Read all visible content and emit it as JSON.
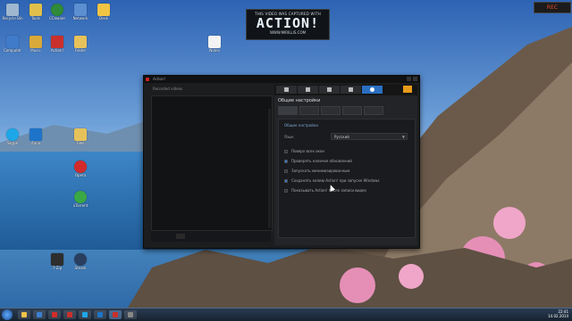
{
  "banner": {
    "line1": "THIS VIDEO WAS CAPTURED WITH",
    "logo": "ACTION!",
    "url": "WWW.MIRILLIS.COM"
  },
  "recorder": {
    "label": "REC"
  },
  "desktop_icons": [
    {
      "label": "Recycle Bin",
      "color": "#9fb7cf"
    },
    {
      "label": "Tools",
      "color": "#e0c04a"
    },
    {
      "label": "CCleaner",
      "color": "#2f8a3a"
    },
    {
      "label": "Network",
      "color": "#5b8fd1"
    },
    {
      "label": "Desk",
      "color": "#f2c443"
    },
    {
      "label": "Computer",
      "color": "#3f7bc9"
    },
    {
      "label": "Music",
      "color": "#d9a93a"
    },
    {
      "label": "Action!",
      "color": "#c9302c"
    },
    {
      "label": "Folder",
      "color": "#e7c25a"
    },
    {
      "label": "Skype",
      "color": "#1ea7e8"
    },
    {
      "label": "Zona",
      "color": "#1d74c8"
    },
    {
      "label": "Files",
      "color": "#e7c25a"
    },
    {
      "label": "Opera",
      "color": "#d32b2b"
    },
    {
      "label": "uTorrent",
      "color": "#3aa845"
    },
    {
      "label": "Steam",
      "color": "#2a3f5f"
    },
    {
      "label": "7-Zip",
      "color": "#2e2e2e"
    },
    {
      "label": "Notes",
      "color": "#f3f3f3"
    }
  ],
  "window": {
    "title": "Action!",
    "left_header": "Recorded videos",
    "section_title": "Общие настройки",
    "panel_header": "Общие настройки",
    "language_label": "Язык",
    "language_value": "Русский",
    "options": [
      {
        "label": "Поверх всех окон",
        "checked": false
      },
      {
        "label": "Проверять наличие обновлений",
        "checked": true
      },
      {
        "label": "Запускать минимизированным",
        "checked": false
      },
      {
        "label": "Сохранять копию Action! при запуске Windows",
        "checked": true
      },
      {
        "label": "Показывать Action! после записи видео",
        "checked": false
      }
    ]
  },
  "taskbar": {
    "time": "22:41",
    "date": "14.02.2014",
    "items": [
      {
        "name": "explorer",
        "color": "#f0c24a"
      },
      {
        "name": "media",
        "color": "#3a80d0"
      },
      {
        "name": "opera",
        "color": "#d32b2b"
      },
      {
        "name": "action",
        "color": "#c9302c"
      },
      {
        "name": "skype",
        "color": "#1ea7e8"
      },
      {
        "name": "zona",
        "color": "#1d74c8"
      },
      {
        "name": "action-window",
        "color": "#c9302c"
      },
      {
        "name": "app",
        "color": "#888"
      }
    ]
  }
}
